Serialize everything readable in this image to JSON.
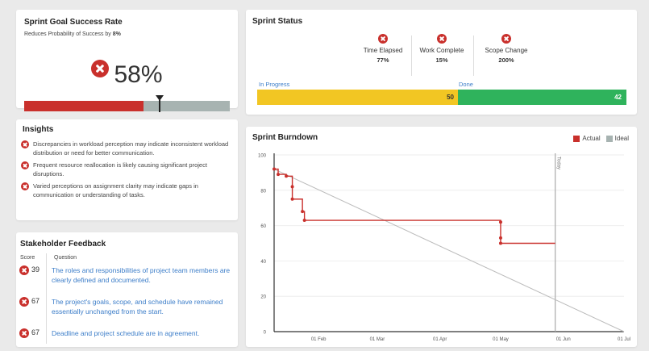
{
  "goal": {
    "title": "Sprint Goal Success Rate",
    "subtitle_prefix": "Reduces Probability of Success by ",
    "subtitle_value": "8%",
    "rate": "58%",
    "rate_fraction": 0.58,
    "colors": {
      "risk": "#c9302c",
      "remaining": "#a7b3b1"
    }
  },
  "insights": {
    "title": "Insights",
    "items": [
      {
        "icon": "error-x-icon",
        "text": "Discrepancies in workload perception may indicate inconsistent workload distribution or need for better communication."
      },
      {
        "icon": "error-x-icon",
        "text": "Frequent resource reallocation is likely causing significant project disruptions."
      },
      {
        "icon": "error-x-icon",
        "text": "Varied perceptions on assignment clarity may indicate gaps in communication or understanding of tasks."
      }
    ]
  },
  "feedback": {
    "title": "Stakeholder Feedback",
    "col_score": "Score",
    "col_question": "Question",
    "rows": [
      {
        "score": "39",
        "question": "The roles and responsibilities of project team members are clearly defined and documented."
      },
      {
        "score": "67",
        "question": "The project's goals, scope, and schedule have remained essentially unchanged from the start."
      },
      {
        "score": "67",
        "question": "Deadline and project schedule are in agreement."
      }
    ]
  },
  "status": {
    "title": "Sprint Status",
    "metrics": [
      {
        "label": "Time Elapsed",
        "value": "77%",
        "icon": "error-x-icon"
      },
      {
        "label": "Work Complete",
        "value": "15%",
        "icon": "error-x-icon"
      },
      {
        "label": "Scope Change",
        "value": "200%",
        "icon": "error-x-icon"
      }
    ],
    "in_progress_label": "In Progress",
    "done_label": "Done",
    "in_progress_value": "50",
    "done_value": "42",
    "colors": {
      "in_progress": "#f2c623",
      "done": "#2fb35c"
    }
  },
  "burndown": {
    "title": "Sprint Burndown",
    "legend_actual": "Actual",
    "legend_ideal": "Ideal",
    "today_label": "Today"
  },
  "chart_data": {
    "type": "line",
    "title": "Sprint Burndown",
    "y_ticks": [
      0,
      20,
      40,
      60,
      80,
      100
    ],
    "ylim": [
      0,
      100
    ],
    "x_ticks": [
      "01 Feb",
      "01 Mar",
      "01 Apr",
      "01 May",
      "01 Jun",
      "01 Jul"
    ],
    "xlim": [
      "2024-01-10",
      "2024-07-01"
    ],
    "today": "2024-05-28",
    "grid": "horizontal",
    "legend": "top-right",
    "series": [
      {
        "name": "Actual",
        "color": "#c9302c",
        "step": true,
        "points": [
          [
            "2024-01-10",
            92
          ],
          [
            "2024-01-12",
            89
          ],
          [
            "2024-01-16",
            88
          ],
          [
            "2024-01-19",
            82
          ],
          [
            "2024-01-19",
            75
          ],
          [
            "2024-01-24",
            68
          ],
          [
            "2024-01-25",
            63
          ],
          [
            "2024-05-01",
            62
          ],
          [
            "2024-05-01",
            53
          ],
          [
            "2024-05-01",
            50
          ],
          [
            "2024-05-28",
            50
          ]
        ]
      },
      {
        "name": "Ideal",
        "color": "#bbbbbb",
        "step": false,
        "points": [
          [
            "2024-01-10",
            92
          ],
          [
            "2024-07-01",
            0
          ]
        ]
      }
    ]
  }
}
